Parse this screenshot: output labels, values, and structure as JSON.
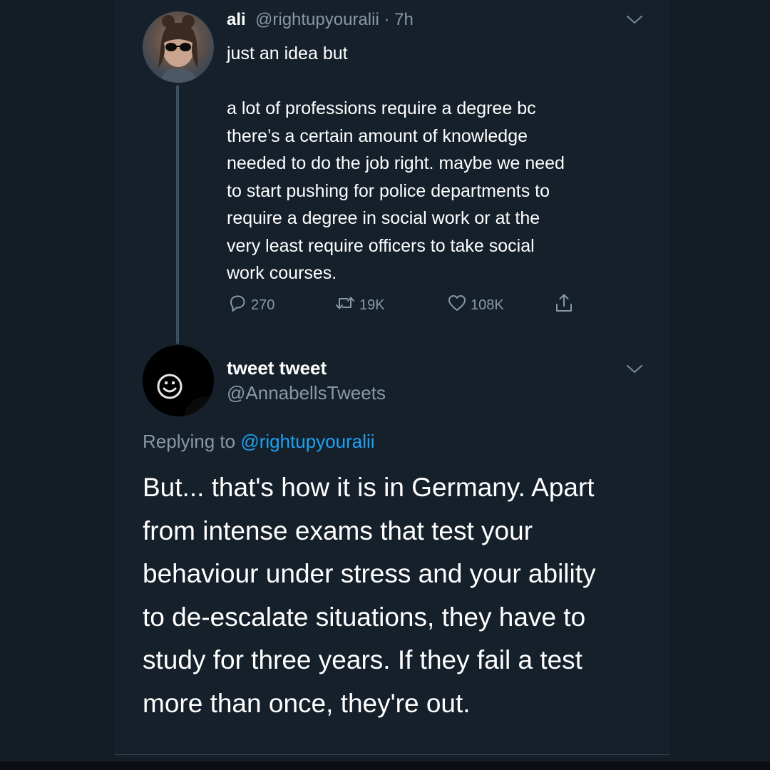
{
  "tweet1": {
    "name": "ali",
    "handle_time": "@rightupyouralii · 7h",
    "text": "just an idea but\n\na lot of professions require a degree bc\nthere’s a certain amount of knowledge\nneeded to do the job right. maybe we need\nto start pushing for police departments to\nrequire a degree in social work or at the\nvery least require officers to take social\nwork courses.",
    "actions": {
      "replies": "270",
      "retweets": "19K",
      "likes": "108K"
    }
  },
  "tweet2": {
    "name": "tweet tweet",
    "handle": "@AnnabellsTweets",
    "replying_prefix": "Replying to",
    "replying_to": "@rightupyouralii",
    "text": "But... that's how it is in Germany. Apart\nfrom intense exams that test your\nbehaviour under stress and your ability\nto de-escalate situations, they have to\nstudy for three years. If they fail a test\nmore than once, they're out."
  },
  "icons": {
    "reply": "reply-icon",
    "retweet": "retweet-icon",
    "like": "heart-icon",
    "share": "share-icon",
    "menu": "chevron-down-icon"
  },
  "colors": {
    "background": "#15202b",
    "secondary_text": "#8899a6",
    "link": "#1da1f2"
  }
}
